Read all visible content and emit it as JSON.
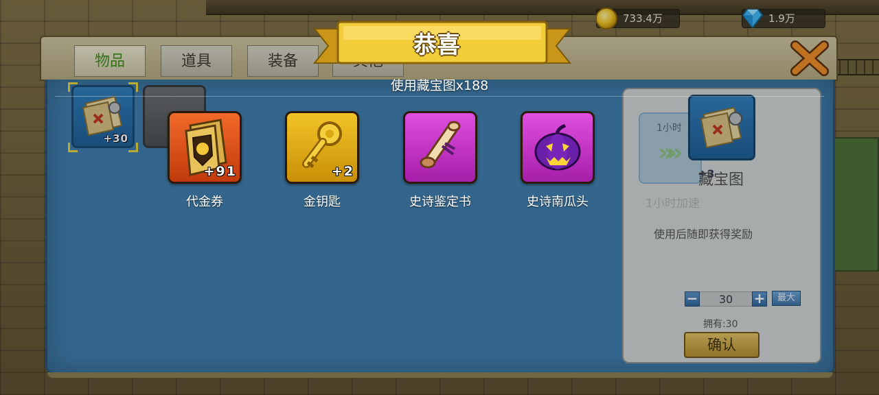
{
  "resources": {
    "gold": "733.4万",
    "gems": "1.9万"
  },
  "tabs": [
    {
      "label": "物品",
      "active": true
    },
    {
      "label": "道具",
      "active": false
    },
    {
      "label": "装备",
      "active": false
    },
    {
      "label": "其他",
      "active": false
    }
  ],
  "inventory": {
    "slot1_count": "+30",
    "slot2_count": "-"
  },
  "detail": {
    "item_name": "藏宝图",
    "ghost_top": "1小时",
    "ghost_plus": "+3",
    "ghost_label": "1小时加速",
    "description": "使用后随即获得奖励",
    "quantity": "30",
    "minus": "−",
    "plus": "+",
    "max_label": "最大",
    "owned": "拥有:30",
    "confirm_label": "确认"
  },
  "popup": {
    "title": "恭喜",
    "subtitle": "使用藏宝图x188",
    "rewards": [
      {
        "name": "代金券",
        "count": "+91",
        "color": "orange",
        "icon": "voucher-icon"
      },
      {
        "name": "金钥匙",
        "count": "+2",
        "color": "yellow",
        "icon": "golden-key-icon"
      },
      {
        "name": "史诗鉴定书",
        "count": "",
        "color": "purple",
        "icon": "scroll-icon"
      },
      {
        "name": "史诗南瓜头",
        "count": "",
        "color": "purple",
        "icon": "pumpkin-icon"
      }
    ]
  },
  "colors": {
    "accent_green": "#3e8a12",
    "panel_blue": "#3e7aa8",
    "banner_gold": "#f0c82e"
  }
}
